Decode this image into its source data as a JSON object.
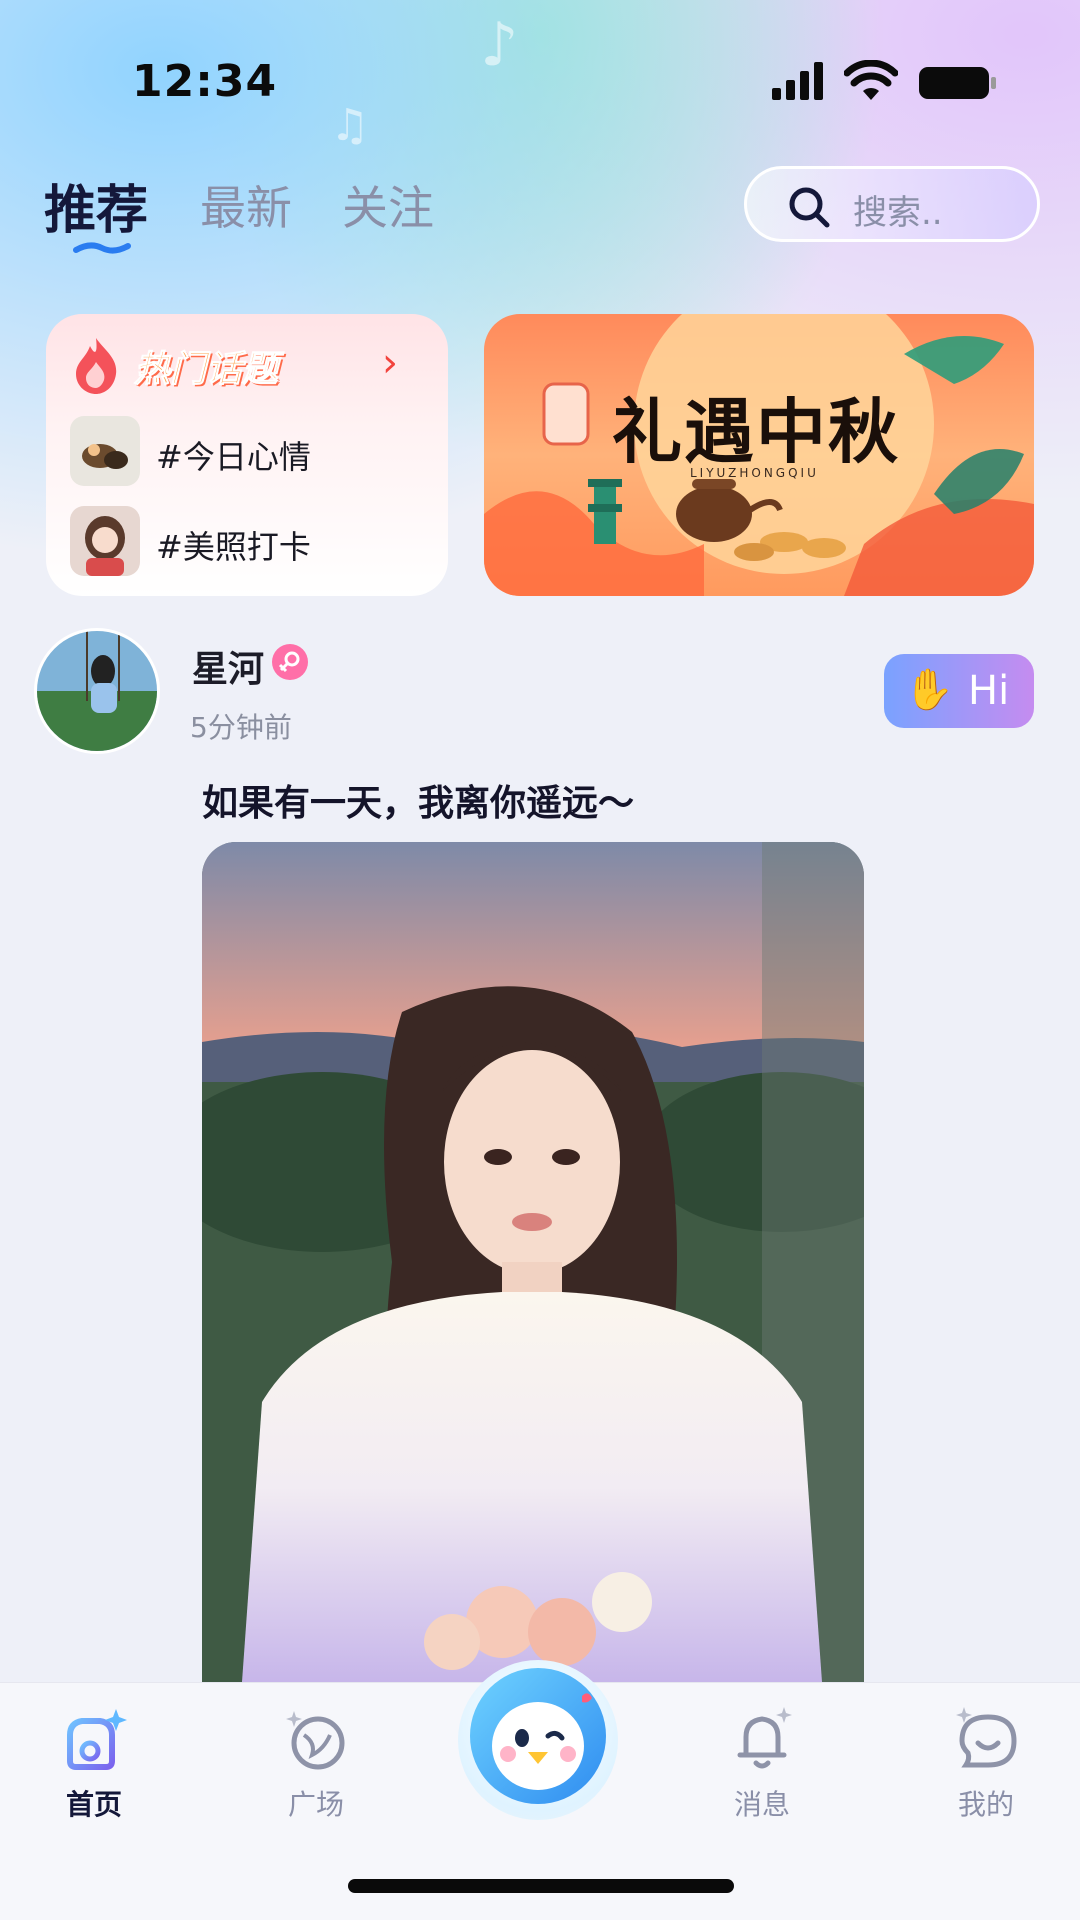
{
  "status_bar": {
    "time": "12:34",
    "signal_icon": "cellular-signal-icon",
    "wifi_icon": "wifi-icon",
    "battery_icon": "battery-icon"
  },
  "tabs": [
    {
      "label": "推荐",
      "active": true
    },
    {
      "label": "最新",
      "active": false
    },
    {
      "label": "关注",
      "active": false
    }
  ],
  "search": {
    "placeholder": "搜索.."
  },
  "hot_topics": {
    "title": "热门话题",
    "items": [
      {
        "label": "#今日心情"
      },
      {
        "label": "#美照打卡"
      }
    ]
  },
  "banner": {
    "title": "礼遇中秋",
    "subtitle": "LIYUZHONGQIU"
  },
  "post": {
    "username": "星河",
    "time": "5分钟前",
    "text": "如果有一天，我离你遥远～",
    "hi_label": "Hi"
  },
  "bottom_nav": [
    {
      "label": "首页",
      "icon": "home-icon",
      "active": true
    },
    {
      "label": "广场",
      "icon": "planet-icon",
      "active": false
    },
    {
      "label": "",
      "icon": "penguin-mascot-icon",
      "active": false
    },
    {
      "label": "消息",
      "icon": "bell-icon",
      "active": false
    },
    {
      "label": "我的",
      "icon": "profile-icon",
      "active": false
    }
  ],
  "colors": {
    "accent_dark": "#14183a",
    "hot_red": "#f2433d",
    "hi_gradient_start": "#7aa2ff",
    "hi_gradient_end": "#c58cf0"
  }
}
